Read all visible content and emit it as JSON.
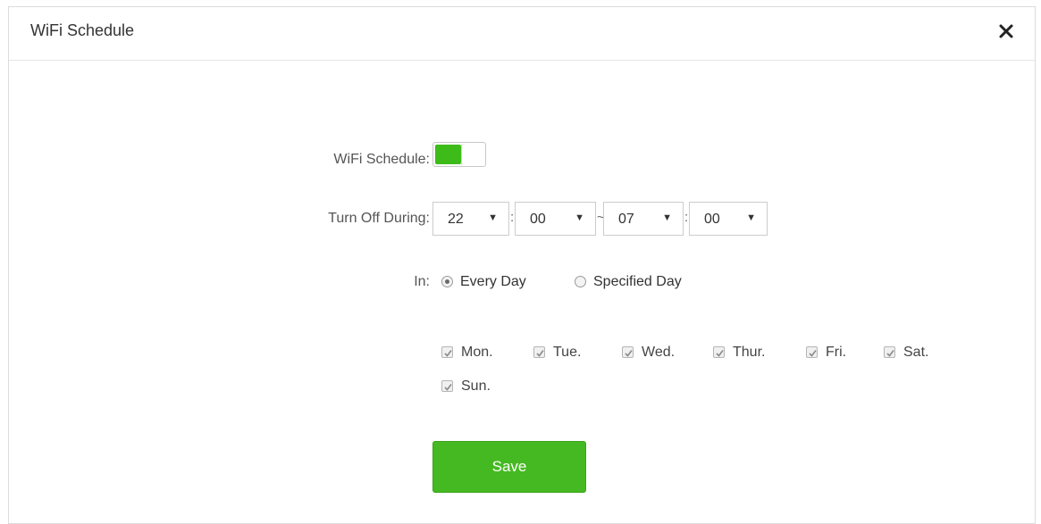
{
  "dialog": {
    "title": "WiFi Schedule",
    "close_icon": "close-icon"
  },
  "form": {
    "schedule_label": "WiFi Schedule:",
    "schedule_enabled": true,
    "turn_off_label": "Turn Off During:",
    "start_hour": "22",
    "start_minute": "00",
    "end_hour": "07",
    "end_minute": "00",
    "colon": ":",
    "tilde": "~",
    "in_label": "In:",
    "radio_every_day": "Every Day",
    "radio_specified_day": "Specified Day",
    "selected_mode": "Every Day",
    "days": [
      {
        "label": "Mon.",
        "checked": true
      },
      {
        "label": "Tue.",
        "checked": true
      },
      {
        "label": "Wed.",
        "checked": true
      },
      {
        "label": "Thur.",
        "checked": true
      },
      {
        "label": "Fri.",
        "checked": true
      },
      {
        "label": "Sat.",
        "checked": true
      },
      {
        "label": "Sun.",
        "checked": true
      }
    ],
    "save_label": "Save"
  },
  "colors": {
    "accent": "#45b921",
    "toggle_on": "#3dbb18"
  }
}
